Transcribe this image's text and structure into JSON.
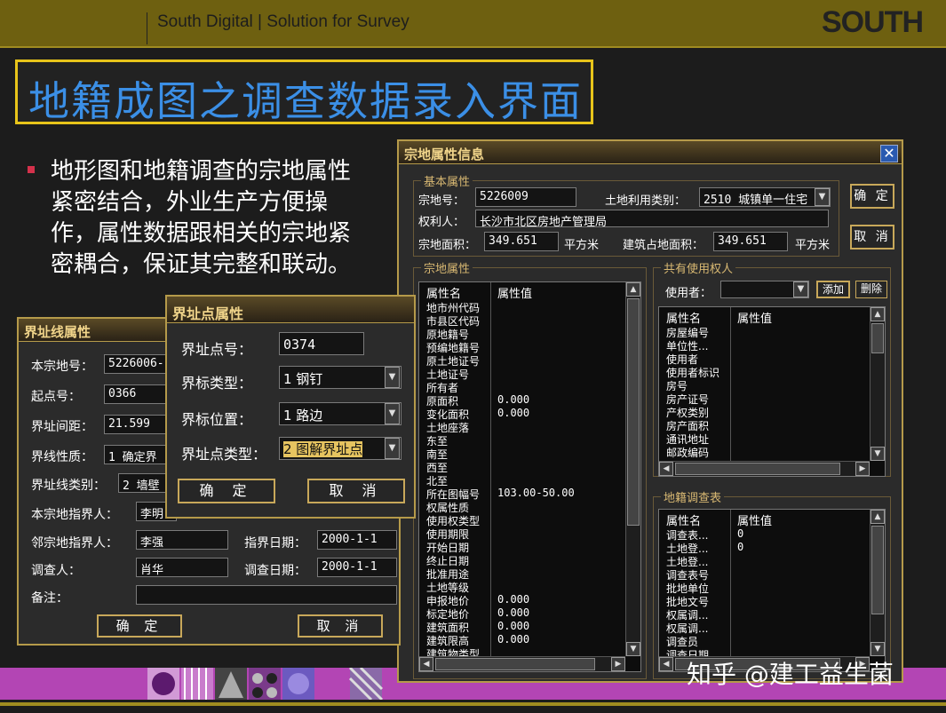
{
  "slide": {
    "header": "South Digital  |  Solution for Survey",
    "logo": "SOUTH",
    "title": "地籍成图之调查数据录入界面",
    "bullet": "地形图和地籍调查的宗地属性紧密结合，外业生产方便操作，属性数据跟相关的宗地紧密耦合，保证其完整和联动。",
    "watermark": "知乎 @建工益生菌"
  },
  "parcel_dialog": {
    "title": "宗地属性信息",
    "basic_group": "基本属性",
    "parcel_no_label": "宗地号：",
    "parcel_no": "5226009",
    "land_use_label": "土地利用类别：",
    "land_use": "2510 城镇单一住宅",
    "owner_label": "权利人：",
    "owner": "长沙市北区房地产管理局",
    "area_label": "宗地面积：",
    "area": "349.651",
    "area_unit": "平方米",
    "building_area_label": "建筑占地面积：",
    "building_area": "349.651",
    "building_area_unit": "平方米",
    "ok_label": "确 定",
    "cancel_label": "取 消",
    "attr_group": "宗地属性",
    "attr_col_name": "属性名",
    "attr_col_value": "属性值",
    "attr_rows": [
      {
        "name": "地市州代码",
        "value": ""
      },
      {
        "name": "市县区代码",
        "value": ""
      },
      {
        "name": "原地籍号",
        "value": ""
      },
      {
        "name": "预编地籍号",
        "value": ""
      },
      {
        "name": "原土地证号",
        "value": ""
      },
      {
        "name": "土地证号",
        "value": ""
      },
      {
        "name": "所有者",
        "value": ""
      },
      {
        "name": "原面积",
        "value": "0.000"
      },
      {
        "name": "变化面积",
        "value": "0.000"
      },
      {
        "name": "土地座落",
        "value": ""
      },
      {
        "name": "东至",
        "value": ""
      },
      {
        "name": "南至",
        "value": ""
      },
      {
        "name": "西至",
        "value": ""
      },
      {
        "name": "北至",
        "value": ""
      },
      {
        "name": "所在图幅号",
        "value": "103.00-50.00"
      },
      {
        "name": "权属性质",
        "value": ""
      },
      {
        "name": "使用权类型",
        "value": ""
      },
      {
        "name": "使用期限",
        "value": ""
      },
      {
        "name": "开始日期",
        "value": ""
      },
      {
        "name": "终止日期",
        "value": ""
      },
      {
        "name": "批准用途",
        "value": ""
      },
      {
        "name": "土地等级",
        "value": ""
      },
      {
        "name": "申报地价",
        "value": "0.000"
      },
      {
        "name": "标定地价",
        "value": "0.000"
      },
      {
        "name": "建筑面积",
        "value": "0.000"
      },
      {
        "name": "建筑限高",
        "value": "0.000"
      },
      {
        "name": "建筑物类型",
        "value": ""
      }
    ],
    "shared_group": "共有使用权人",
    "user_label": "使用者：",
    "user_value": "",
    "add_label": "添加",
    "delete_label": "删除",
    "shared_col_name": "属性名",
    "shared_col_value": "属性值",
    "shared_rows": [
      {
        "name": "房屋编号",
        "value": ""
      },
      {
        "name": "单位性...",
        "value": ""
      },
      {
        "name": "使用者",
        "value": ""
      },
      {
        "name": "使用者标识",
        "value": ""
      },
      {
        "name": "房号",
        "value": ""
      },
      {
        "name": "房产证号",
        "value": ""
      },
      {
        "name": "产权类别",
        "value": ""
      },
      {
        "name": "房产面积",
        "value": ""
      },
      {
        "name": "通讯地址",
        "value": ""
      },
      {
        "name": "邮政编码",
        "value": ""
      }
    ],
    "survey_group": "地籍调查表",
    "survey_col_name": "属性名",
    "survey_col_value": "属性值",
    "survey_rows": [
      {
        "name": "调查表...",
        "value": "0"
      },
      {
        "name": "土地登...",
        "value": "0"
      },
      {
        "name": "土地登...",
        "value": ""
      },
      {
        "name": "调查表号",
        "value": ""
      },
      {
        "name": "批地单位",
        "value": ""
      },
      {
        "name": "批地文号",
        "value": ""
      },
      {
        "name": "权属调...",
        "value": ""
      },
      {
        "name": "权属调...",
        "value": ""
      },
      {
        "name": "调查员",
        "value": ""
      },
      {
        "name": "调查日期",
        "value": ""
      }
    ]
  },
  "boundary_line_dialog": {
    "title": "界址线属性",
    "parcel_label": "本宗地号：",
    "parcel": "5226006-1",
    "start_label": "起点号：",
    "start": "0366",
    "distance_label": "界址间距：",
    "distance": "21.599",
    "nature_label": "界线性质：",
    "nature": "1 确定界",
    "type_label": "界址线类别：",
    "type": "2 墙壁",
    "self_ref_label": "本宗地指界人：",
    "self_ref": "李明",
    "neighbor_ref_label": "邻宗地指界人：",
    "neighbor_ref": "李强",
    "ref_date_label": "指界日期：",
    "ref_date": "2000-1-1",
    "surveyor_label": "调查人：",
    "surveyor": "肖华",
    "survey_date_label": "调查日期：",
    "survey_date": "2000-1-1",
    "remark_label": "备注：",
    "remark": "",
    "ok_label": "确 定",
    "cancel_label": "取 消"
  },
  "boundary_point_dialog": {
    "title": "界址点属性",
    "point_no_label": "界址点号：",
    "point_no": "0374",
    "marker_type_label": "界标类型：",
    "marker_type": "1 钢钉",
    "marker_pos_label": "界标位置：",
    "marker_pos": "1 路边",
    "point_type_label": "界址点类型：",
    "point_type": "2 图解界址点",
    "ok_label": "确 定",
    "cancel_label": "取 消"
  }
}
